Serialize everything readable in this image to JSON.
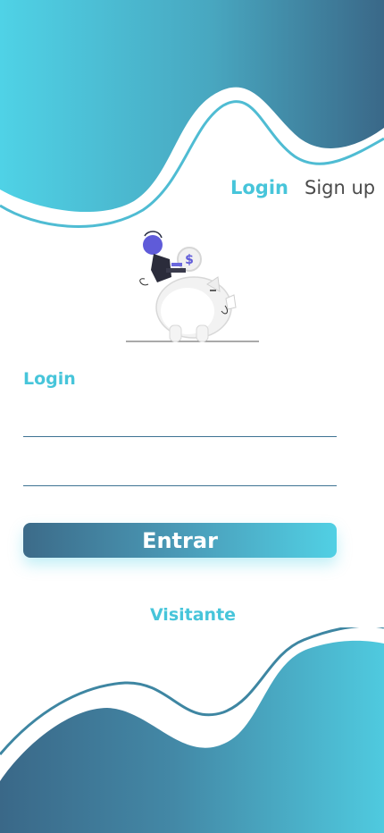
{
  "tabs": {
    "login": "Login",
    "signup": "Sign up"
  },
  "form": {
    "title": "Login",
    "field1": {
      "value": "",
      "placeholder": ""
    },
    "field2": {
      "value": "",
      "placeholder": ""
    },
    "submit_label": "Entrar"
  },
  "visitor": {
    "label": "Visitante"
  },
  "illustration": {
    "name": "piggy-bank-illustration",
    "coin_symbol": "$"
  },
  "colors": {
    "accent": "#47c5da",
    "gradient_start": "#3c6b89",
    "gradient_end": "#51d0e4",
    "text_dark": "#4b4b4b"
  }
}
